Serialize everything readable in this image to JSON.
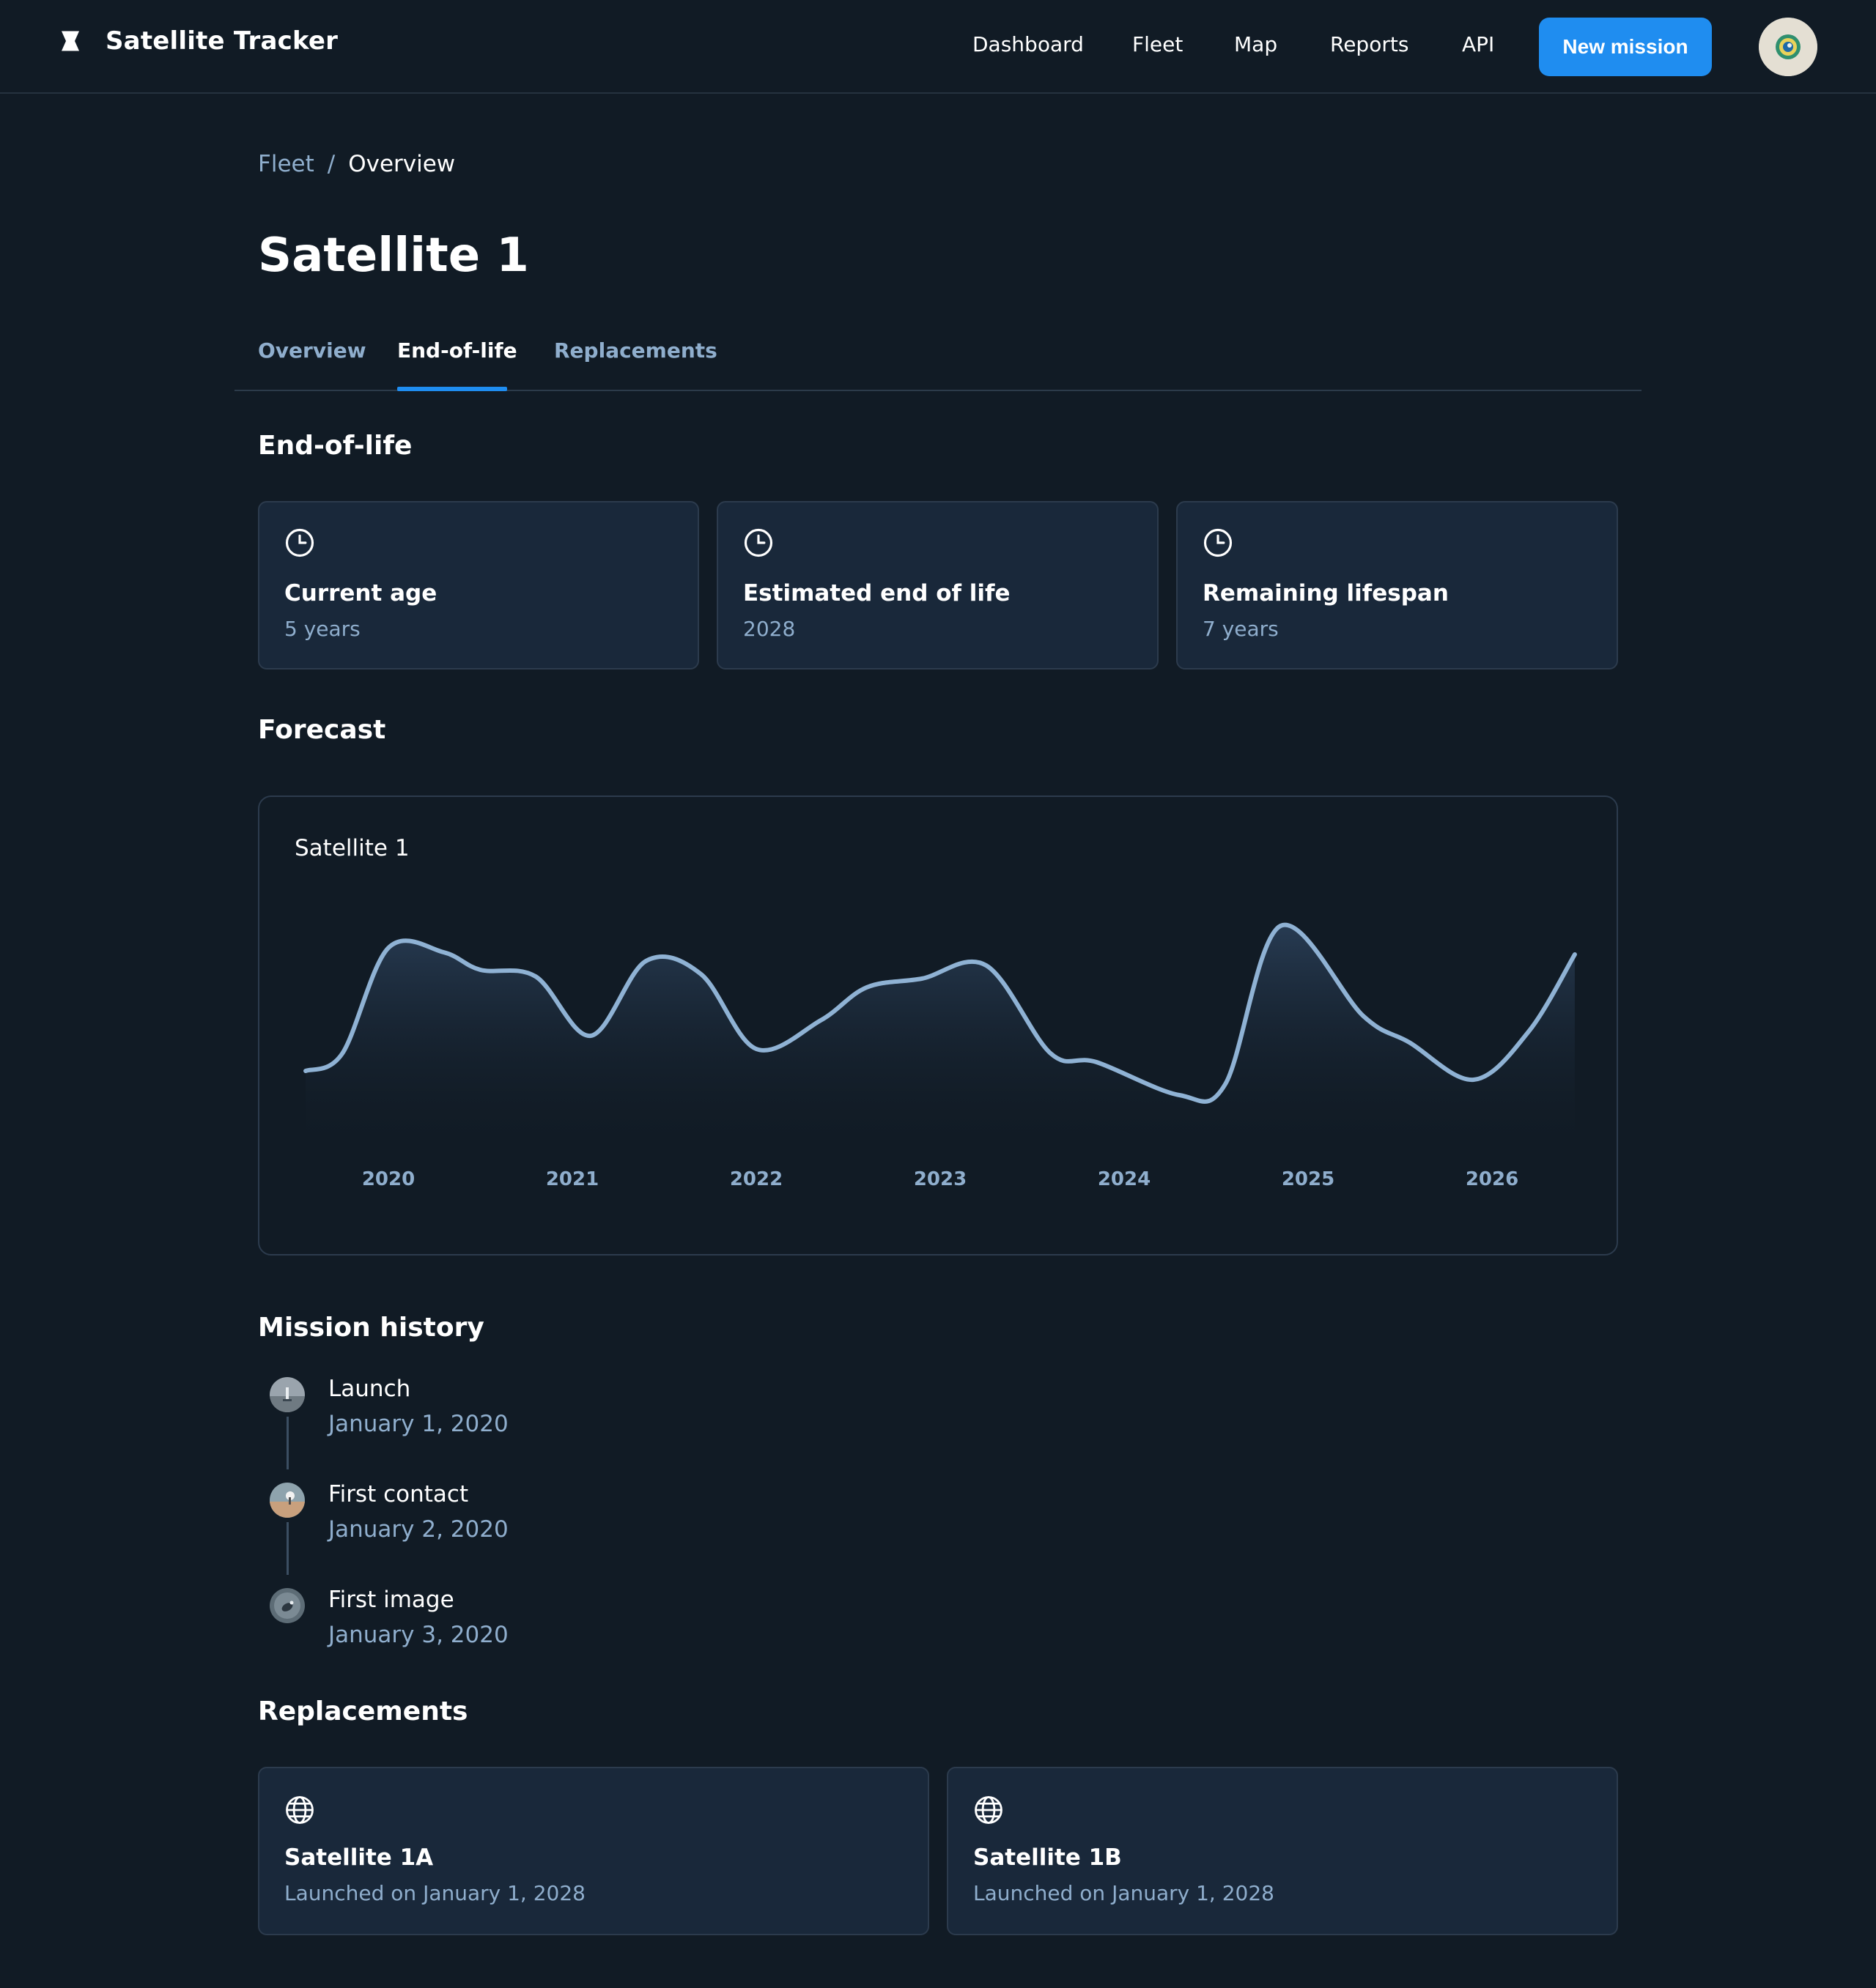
{
  "app": {
    "title": "Satellite Tracker",
    "brand_icon": "satellite-logo-icon"
  },
  "nav": {
    "items": [
      "Dashboard",
      "Fleet",
      "Map",
      "Reports",
      "API"
    ],
    "cta_label": "New mission",
    "accent_color": "#1f8df0"
  },
  "breadcrumb": {
    "parent": "Fleet",
    "separator": "/",
    "current": "Overview"
  },
  "page": {
    "title": "Satellite 1"
  },
  "tabs": {
    "items": [
      "Overview",
      "End-of-life",
      "Replacements"
    ],
    "active": "End-of-life"
  },
  "end_of_life": {
    "heading": "End-of-life",
    "cards": [
      {
        "icon": "clock-icon",
        "title": "Current age",
        "value": "5 years"
      },
      {
        "icon": "clock-icon",
        "title": "Estimated end of life",
        "value": "2028"
      },
      {
        "icon": "clock-icon",
        "title": "Remaining lifespan",
        "value": "7 years"
      }
    ]
  },
  "forecast": {
    "heading": "Forecast"
  },
  "chart_data": {
    "type": "area",
    "title": "Satellite 1",
    "x_ticks": [
      "2020",
      "2021",
      "2022",
      "2023",
      "2024",
      "2025",
      "2026"
    ],
    "series": [
      {
        "name": "Satellite 1",
        "x": [
          2019.55,
          2019.75,
          2020.0,
          2020.3,
          2020.5,
          2020.8,
          2021.1,
          2021.4,
          2021.7,
          2022.0,
          2022.35,
          2022.6,
          2022.9,
          2023.25,
          2023.6,
          2023.85,
          2024.3,
          2024.55,
          2024.85,
          2025.3,
          2025.55,
          2025.9,
          2026.2,
          2026.45
        ],
        "values": [
          22,
          30,
          78,
          76,
          68,
          65,
          38,
          72,
          66,
          32,
          45,
          60,
          64,
          70,
          30,
          26,
          11,
          16,
          88,
          47,
          35,
          18,
          40,
          75
        ]
      }
    ],
    "ylim": [
      0,
      100
    ],
    "grid": false,
    "line_color": "#8fb2d4"
  },
  "mission_history": {
    "heading": "Mission history",
    "events": [
      {
        "title": "Launch",
        "date": "January 1, 2020",
        "icon": "launch-thumbnail-icon"
      },
      {
        "title": "First contact",
        "date": "January 2, 2020",
        "icon": "contact-thumbnail-icon"
      },
      {
        "title": "First image",
        "date": "January 3, 2020",
        "icon": "image-thumbnail-icon"
      }
    ]
  },
  "replacements": {
    "heading": "Replacements",
    "items": [
      {
        "icon": "globe-icon",
        "name": "Satellite 1A",
        "detail": "Launched on January 1, 2028"
      },
      {
        "icon": "globe-icon",
        "name": "Satellite 1B",
        "detail": "Launched on January 1, 2028"
      }
    ]
  }
}
